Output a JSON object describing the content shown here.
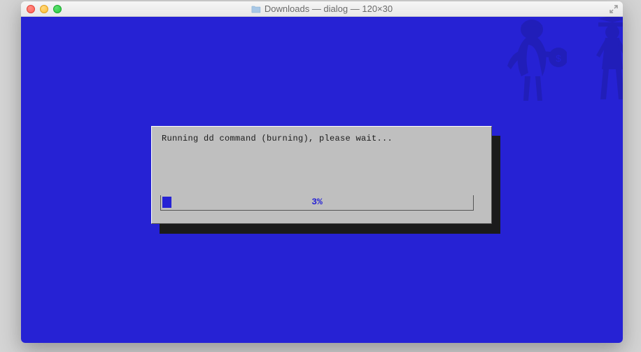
{
  "window": {
    "title": "Downloads — dialog — 120×30"
  },
  "dialog": {
    "message": "Running dd command (burning), please wait...",
    "progress_percent": 3,
    "progress_label": "3%"
  },
  "colors": {
    "terminal_bg": "#2622d4",
    "dialog_bg": "#bfbfbf",
    "progress_fill": "#2622d4"
  }
}
